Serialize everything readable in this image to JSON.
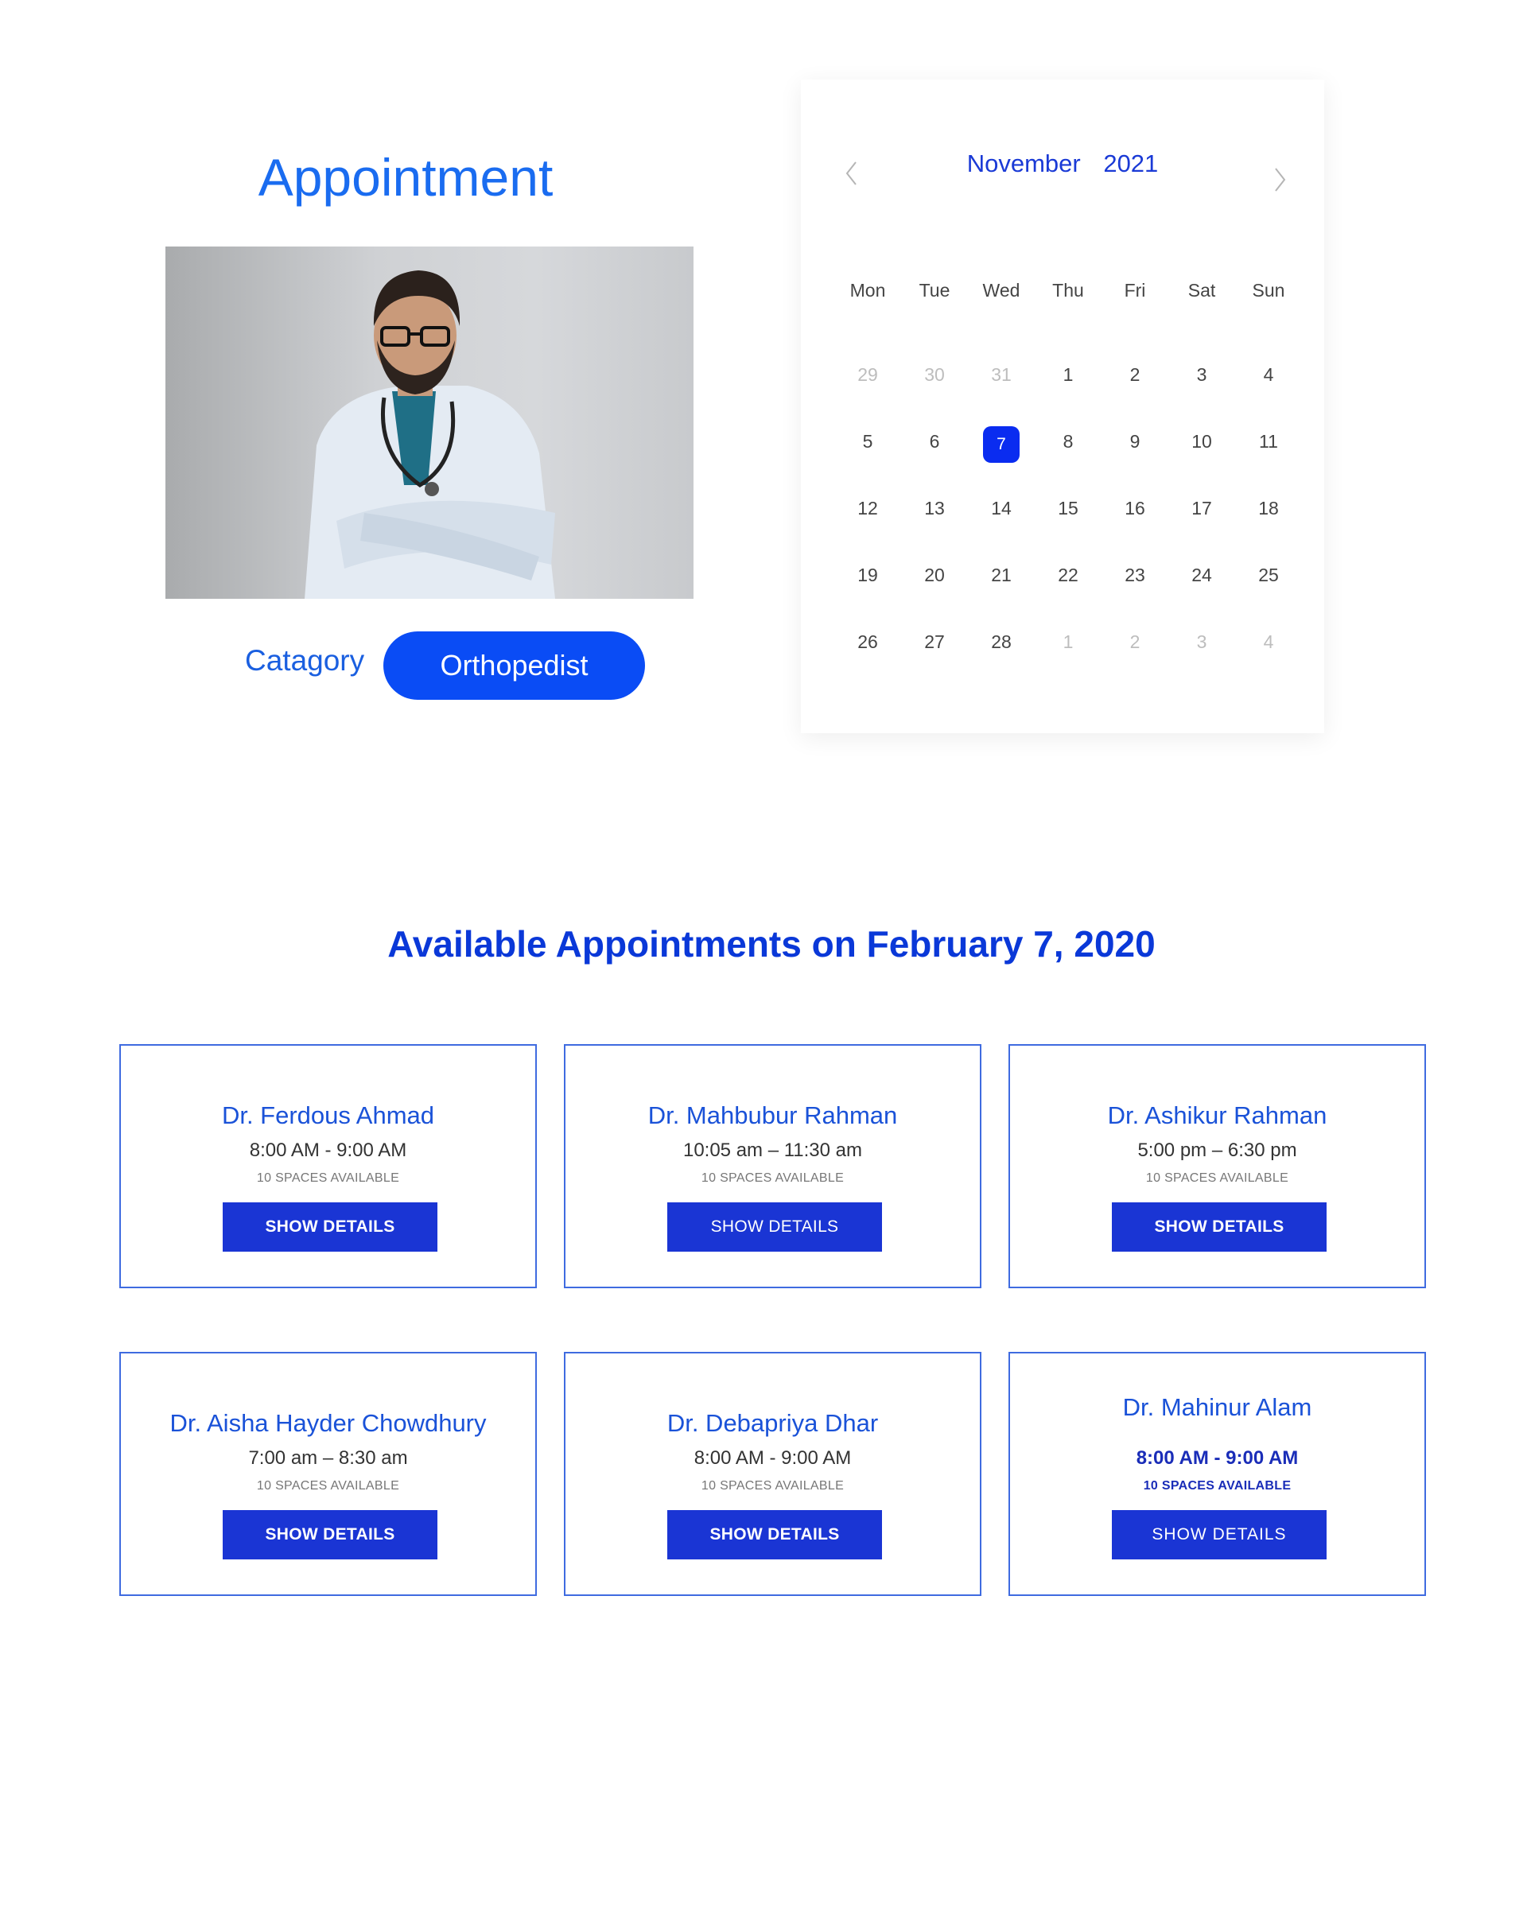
{
  "header": {
    "title": "Appointment"
  },
  "category": {
    "label": "Catagory",
    "value": "Orthopedist"
  },
  "calendar": {
    "month": "November",
    "year": "2021",
    "weekdays": [
      "Mon",
      "Tue",
      "Wed",
      "Thu",
      "Fri",
      "Sat",
      "Sun"
    ],
    "weeks": [
      [
        {
          "d": "29",
          "m": true
        },
        {
          "d": "30",
          "m": true
        },
        {
          "d": "31",
          "m": true
        },
        {
          "d": "1"
        },
        {
          "d": "2"
        },
        {
          "d": "3"
        },
        {
          "d": "4"
        }
      ],
      [
        {
          "d": "5"
        },
        {
          "d": "6"
        },
        {
          "d": "7",
          "s": true
        },
        {
          "d": "8"
        },
        {
          "d": "9"
        },
        {
          "d": "10"
        },
        {
          "d": "11"
        }
      ],
      [
        {
          "d": "12"
        },
        {
          "d": "13"
        },
        {
          "d": "14"
        },
        {
          "d": "15"
        },
        {
          "d": "16"
        },
        {
          "d": "17"
        },
        {
          "d": "18"
        }
      ],
      [
        {
          "d": "19"
        },
        {
          "d": "20"
        },
        {
          "d": "21"
        },
        {
          "d": "22"
        },
        {
          "d": "23"
        },
        {
          "d": "24"
        },
        {
          "d": "25"
        }
      ],
      [
        {
          "d": "26"
        },
        {
          "d": "27"
        },
        {
          "d": "28"
        },
        {
          "d": "1",
          "m": true
        },
        {
          "d": "2",
          "m": true
        },
        {
          "d": "3",
          "m": true
        },
        {
          "d": "4",
          "m": true
        }
      ]
    ]
  },
  "appointments": {
    "title": "Available Appointments on February 7, 2020",
    "cards": [
      {
        "name": "Dr. Ferdous Ahmad",
        "time": "8:00 AM - 9:00 AM",
        "spaces": "10 SPACES AVAILABLE",
        "button": "SHOW DETAILS"
      },
      {
        "name": "Dr. Mahbubur Rahman",
        "time": "10:05 am – 11:30 am",
        "spaces": "10 SPACES AVAILABLE",
        "button": "SHOW DETAILS"
      },
      {
        "name": "Dr. Ashikur Rahman",
        "time": "5:00 pm – 6:30 pm",
        "spaces": "10 SPACES AVAILABLE",
        "button": "SHOW DETAILS"
      },
      {
        "name": "Dr. Aisha Hayder Chowdhury",
        "time": "7:00 am – 8:30 am",
        "spaces": "10 SPACES AVAILABLE",
        "button": "SHOW DETAILS"
      },
      {
        "name": "Dr. Debapriya Dhar",
        "time": "8:00 AM - 9:00 AM",
        "spaces": "10 SPACES AVAILABLE",
        "button": "SHOW DETAILS"
      },
      {
        "name": "Dr. Mahinur Alam",
        "time": "8:00 AM - 9:00 AM",
        "spaces": "10 SPACES AVAILABLE",
        "button": "SHOW DETAILS"
      }
    ]
  },
  "colors": {
    "primary": "#0a4cf5",
    "title_blue": "#1a6cf0",
    "button_blue": "#1a35d4",
    "card_border": "#3f6be0"
  },
  "icons": {
    "prev": "chevron-left-icon",
    "next": "chevron-right-icon"
  }
}
